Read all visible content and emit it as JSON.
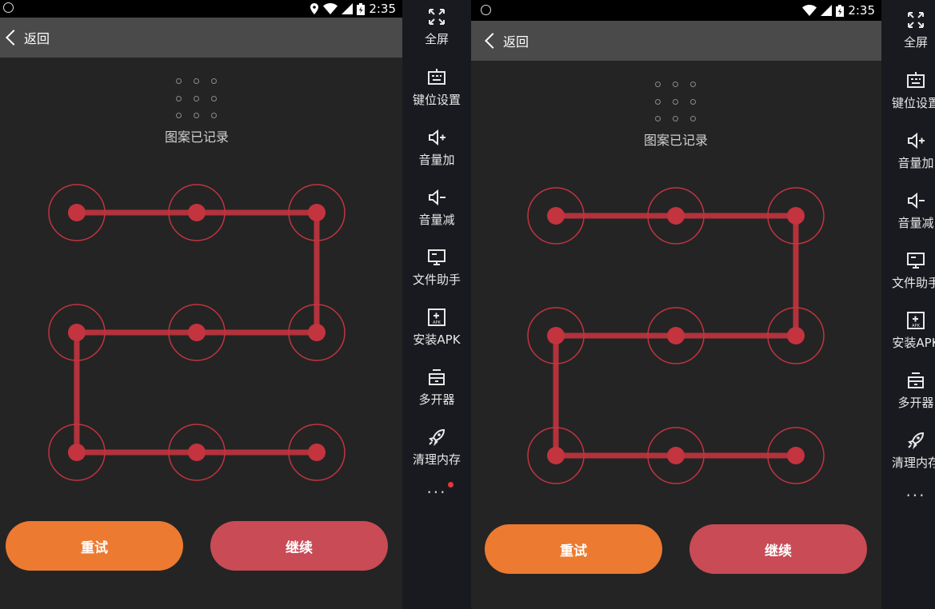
{
  "screens": [
    {
      "status": {
        "time": "2:35"
      },
      "appbar": {
        "back_label": "返回"
      },
      "status_text": "图案已记录",
      "pattern": {
        "sequence": [
          1,
          2,
          3,
          6,
          5,
          4,
          7,
          8,
          9
        ]
      },
      "buttons": {
        "retry": "重试",
        "continue": "继续"
      }
    },
    {
      "status": {
        "time": "2:35"
      },
      "appbar": {
        "back_label": "返回"
      },
      "status_text": "图案已记录",
      "pattern": {
        "sequence": [
          1,
          2,
          3,
          6,
          5,
          4,
          7,
          8,
          9
        ]
      },
      "buttons": {
        "retry": "重试",
        "continue": "继续"
      }
    }
  ],
  "sidebar": {
    "items": [
      {
        "label": "全屏",
        "icon": "fullscreen-icon"
      },
      {
        "label": "键位设置",
        "icon": "keyboard-icon"
      },
      {
        "label": "音量加",
        "icon": "volume-up-icon"
      },
      {
        "label": "音量减",
        "icon": "volume-down-icon"
      },
      {
        "label": "文件助手",
        "icon": "monitor-icon"
      },
      {
        "label": "安装APK",
        "icon": "install-apk-icon"
      },
      {
        "label": "多开器",
        "icon": "multi-open-icon"
      },
      {
        "label": "清理内存",
        "icon": "rocket-icon"
      }
    ],
    "more": "···",
    "apk_icon_text": "APK"
  },
  "colors": {
    "accent_red": "#c3343f",
    "retry_orange": "#ec7a30",
    "continue_red": "#c84b55",
    "panel_bg": "#242424",
    "sidebar_bg": "#181a1f"
  }
}
